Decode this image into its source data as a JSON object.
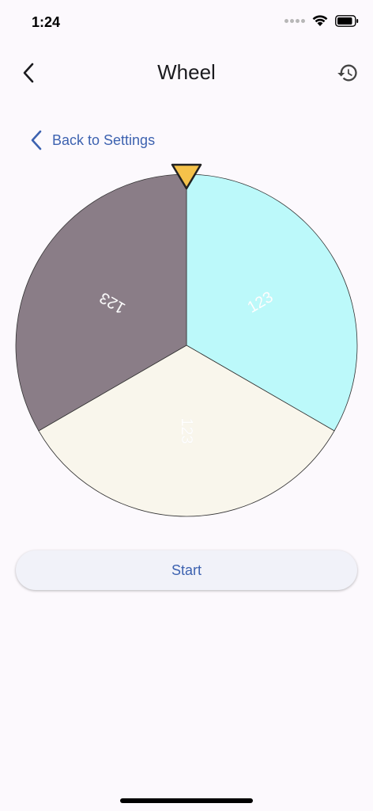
{
  "status_bar": {
    "time": "1:24",
    "icons": [
      "signal-dots-icon",
      "wifi-icon",
      "battery-icon"
    ]
  },
  "app_bar": {
    "title": "Wheel",
    "back_icon": "chevron-left-icon",
    "history_icon": "history-icon"
  },
  "back_link": {
    "label": "Back to Settings",
    "icon": "chevron-left-icon"
  },
  "wheel": {
    "pointer_color": "#f5c24a",
    "segments": [
      {
        "label": "123",
        "color": "#bcf9fa"
      },
      {
        "label": "123",
        "color": "#f9f6ec"
      },
      {
        "label": "123",
        "color": "#8a7d87"
      }
    ]
  },
  "start_button": {
    "label": "Start"
  },
  "colors": {
    "accent": "#3d62b0",
    "background": "#fcf9fd"
  }
}
